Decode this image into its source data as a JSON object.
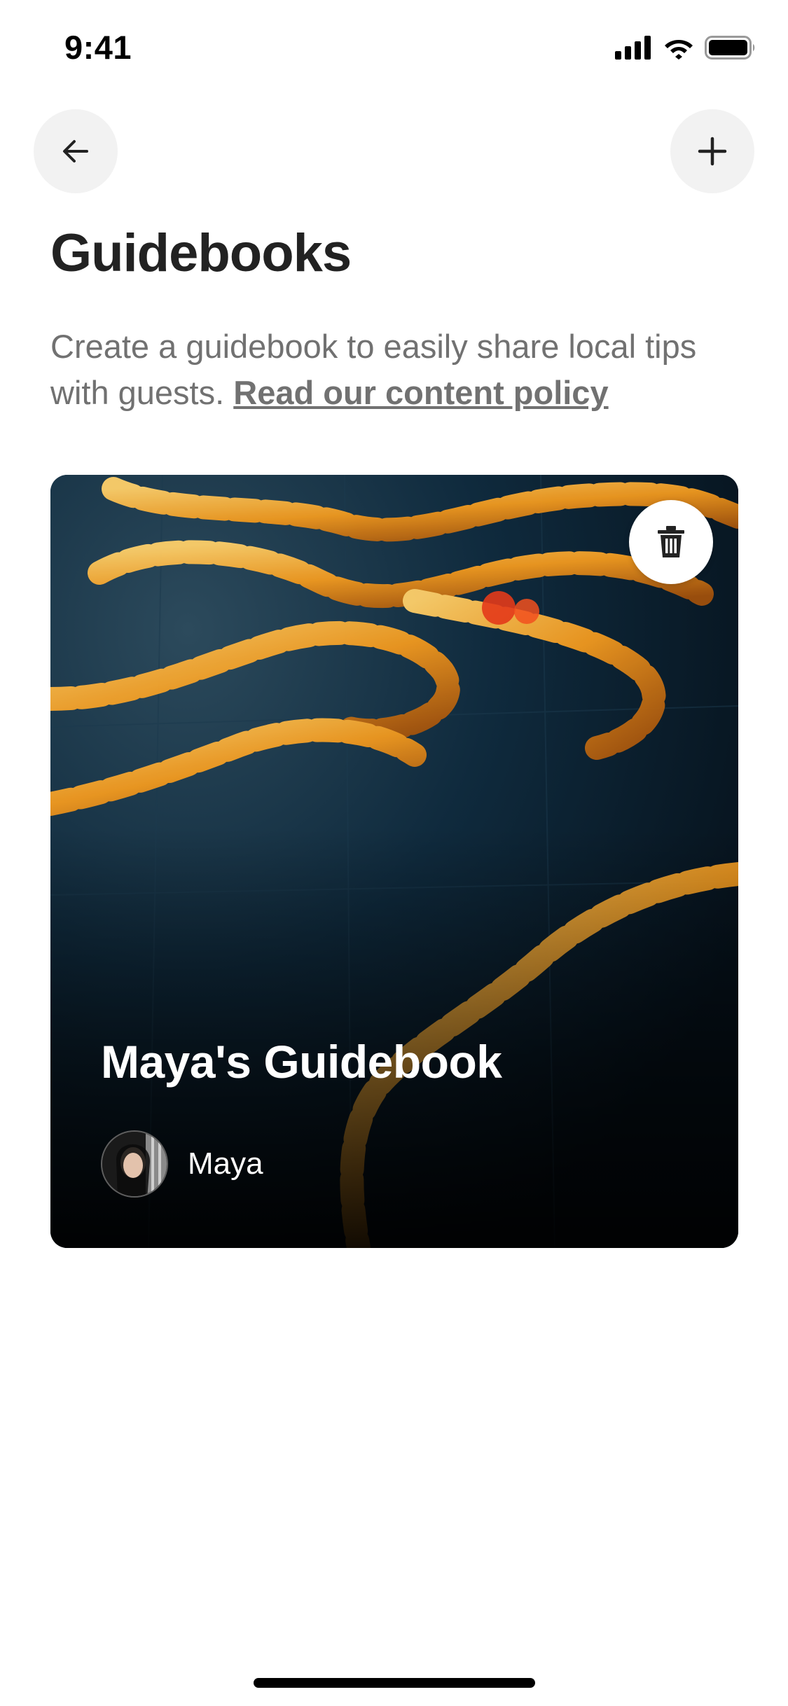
{
  "status_bar": {
    "time": "9:41",
    "icons": [
      "signal-icon",
      "wifi-icon",
      "battery-icon"
    ]
  },
  "nav": {
    "back_icon": "arrow-left-icon",
    "add_icon": "plus-icon"
  },
  "page": {
    "title": "Guidebooks",
    "description": "Create a guidebook to easily share local tips with guests.",
    "policy_link": "Read our content policy"
  },
  "guidebooks": [
    {
      "title": "Maya's Guidebook",
      "author": "Maya",
      "delete_icon": "trash-icon"
    }
  ],
  "colors": {
    "text_primary": "#222222",
    "text_secondary": "#717171",
    "button_bg": "#f2f2f2",
    "card_bg": "#0d2436",
    "accent_orange": "#f0a024"
  }
}
